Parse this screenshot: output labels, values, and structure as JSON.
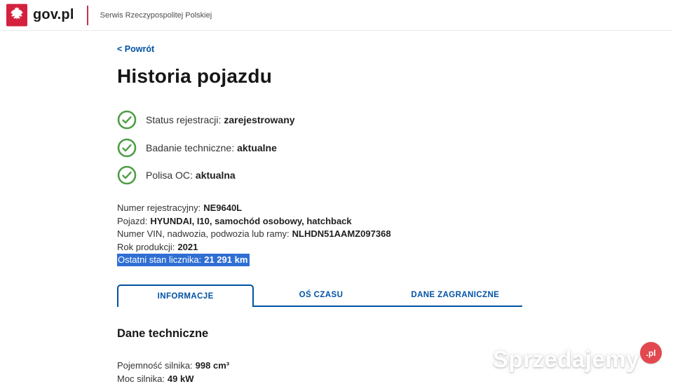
{
  "header": {
    "brand": "gov.pl",
    "tagline": "Serwis Rzeczypospolitej Polskiej"
  },
  "page": {
    "back_link": "< Powrót",
    "title": "Historia pojazdu"
  },
  "statuses": [
    {
      "label": "Status rejestracji:",
      "value": "zarejestrowany"
    },
    {
      "label": "Badanie techniczne:",
      "value": "aktualne"
    },
    {
      "label": "Polisa OC:",
      "value": "aktualna"
    }
  ],
  "details": [
    {
      "label": "Numer rejestracyjny:",
      "value": "NE9640L"
    },
    {
      "label": "Pojazd:",
      "value": "HYUNDAI, I10, samochód osobowy, hatchback"
    },
    {
      "label": "Numer VIN, nadwozia, podwozia lub ramy:",
      "value": "NLHDN51AAMZ097368"
    },
    {
      "label": "Rok produkcji:",
      "value": "2021"
    },
    {
      "label": "Ostatni stan licznika:",
      "value": "21 291 km"
    }
  ],
  "tabs": [
    {
      "label": "INFORMACJE",
      "active": true
    },
    {
      "label": "OŚ CZASU",
      "active": false
    },
    {
      "label": "DANE ZAGRANICZNE",
      "active": false
    }
  ],
  "technical": {
    "heading": "Dane techniczne",
    "items": [
      {
        "label": "Pojemność silnika:",
        "value": "998 cm³"
      },
      {
        "label": "Moc silnika:",
        "value": "49 kW"
      }
    ]
  },
  "watermark": {
    "text": "Sprzedajemy",
    "suffix": ".pl"
  },
  "colors": {
    "accent_blue": "#0052a5",
    "selection_blue": "#2f6fd4",
    "check_green": "#4e9d45",
    "brand_red": "#d4213d",
    "watermark_red": "#e2484f"
  }
}
